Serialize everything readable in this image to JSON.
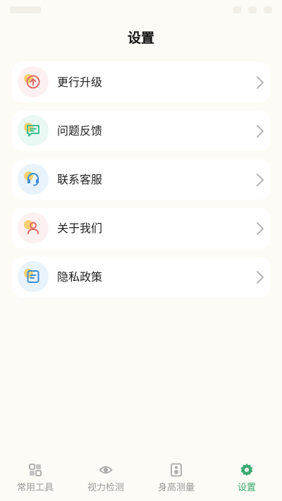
{
  "header": {
    "title": "设置"
  },
  "menu": [
    {
      "label": "更行升级",
      "icon": "upgrade-icon",
      "bg": "#fdf0f0",
      "color": "#e06a6a"
    },
    {
      "label": "问题反馈",
      "icon": "feedback-icon",
      "bg": "#eaf8f3",
      "color": "#3cbf8f"
    },
    {
      "label": "联系客服",
      "icon": "headset-icon",
      "bg": "#e9f3fc",
      "color": "#3b8fd6"
    },
    {
      "label": "关于我们",
      "icon": "user-icon",
      "bg": "#fdf0f0",
      "color": "#e06a6a"
    },
    {
      "label": "隐私政策",
      "icon": "document-icon",
      "bg": "#e9f3fc",
      "color": "#3b8fd6"
    }
  ],
  "tabs": [
    {
      "label": "常用工具",
      "icon": "grid-icon"
    },
    {
      "label": "视力检测",
      "icon": "eye-icon"
    },
    {
      "label": "身高测量",
      "icon": "ruler-person-icon"
    },
    {
      "label": "设置",
      "icon": "gear-icon",
      "active": true
    }
  ],
  "colors": {
    "accent": "#3aaa72",
    "inactive": "#9a9a9a",
    "background": "#fdfbf5"
  }
}
